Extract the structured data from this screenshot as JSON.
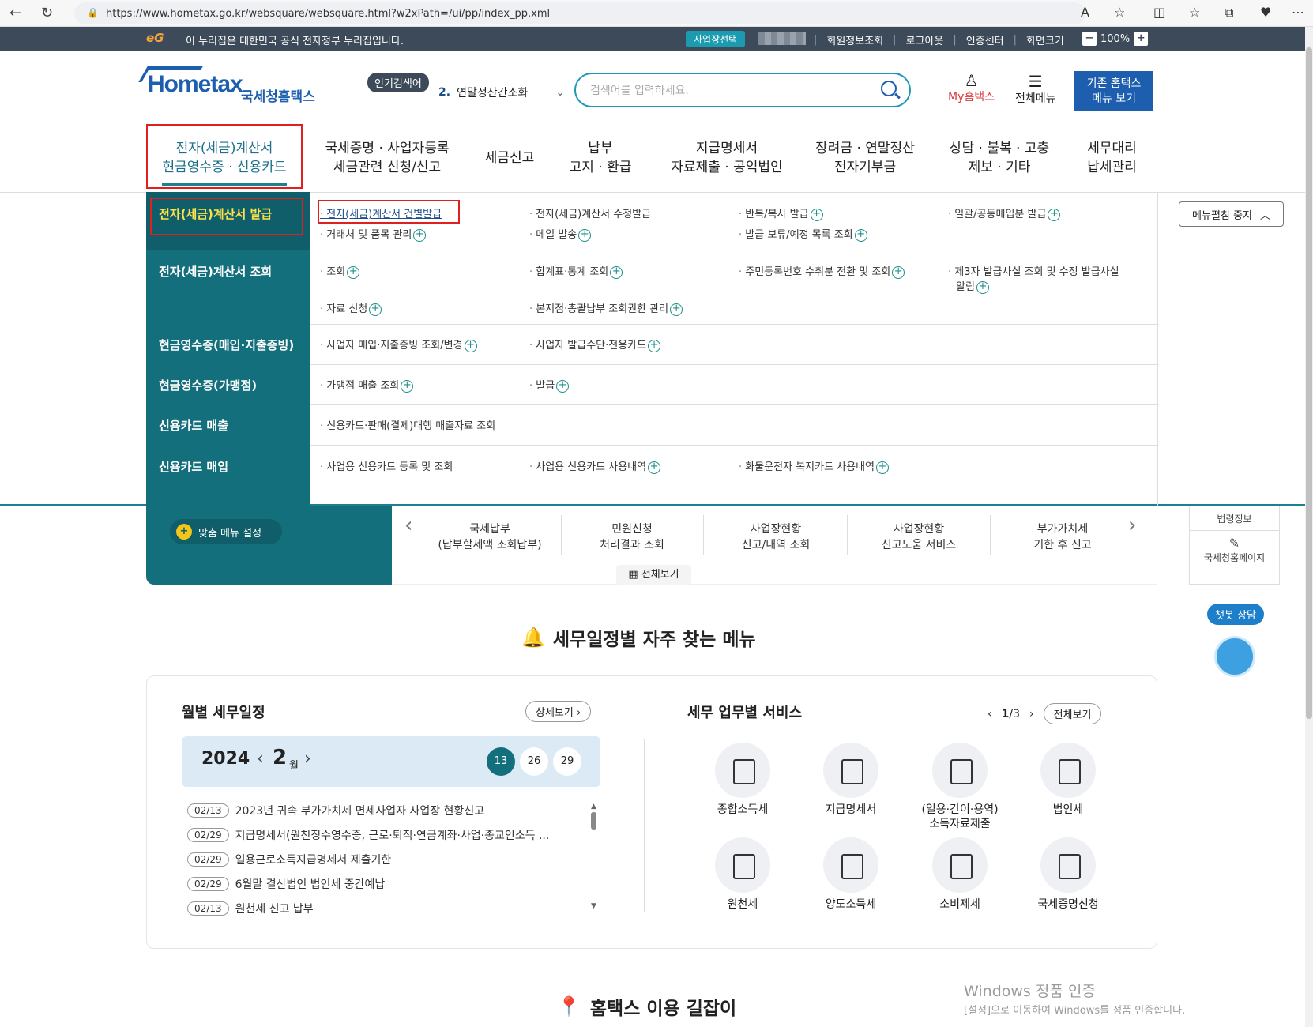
{
  "browser": {
    "url": "https://www.hometax.go.kr/websquare/websquare.html?w2xPath=/ui/pp/index_pp.xml"
  },
  "gov_banner": {
    "text": "이 누리집은 대한민국 공식 전자정부 누리집입니다.",
    "biz_select": "사업장선택",
    "links": [
      "회원정보조회",
      "로그아웃",
      "인증센터",
      "화면크기"
    ],
    "zoom": "100%"
  },
  "header": {
    "logo_en": "Hometax",
    "logo_kr": "국세청홈택스",
    "popular_label": "인기검색어",
    "popular_rank": "2.",
    "popular_keyword": "연말정산간소화",
    "search_placeholder": "검색어를 입력하세요.",
    "my_label": "My홈택스",
    "all_menu_label": "전체메뉴",
    "old_menu_line1": "기존 홈택스",
    "old_menu_line2": "메뉴 보기"
  },
  "tabs": [
    {
      "l1": "전자(세금)계산서",
      "l2": "현금영수증 · 신용카드"
    },
    {
      "l1": "국세증명 · 사업자등록",
      "l2": "세금관련 신청/신고"
    },
    {
      "l1": "세금신고",
      "l2": ""
    },
    {
      "l1": "납부",
      "l2": "고지 · 환급"
    },
    {
      "l1": "지급명세서",
      "l2": "자료제출 · 공익법인"
    },
    {
      "l1": "장려금 · 연말정산",
      "l2": "전자기부금"
    },
    {
      "l1": "상담 · 불복 · 고충",
      "l2": "제보 · 기타"
    },
    {
      "l1": "세무대리",
      "l2": "납세관리"
    }
  ],
  "mega_menu": {
    "categories": [
      "전자(세금)계산서 발급",
      "전자(세금)계산서 조회",
      "현금영수증(매입·지출증빙)",
      "현금영수증(가맹점)",
      "신용카드 매출",
      "신용카드 매입"
    ],
    "items": {
      "c0": [
        "전자(세금)계산서 건별발급",
        "전자(세금)계산서 수정발급",
        "반복/복사 발급",
        "일괄/공동매입분 발급",
        "거래처 및 품목 관리",
        "메일 발송",
        "발급 보류/예정 목록 조회"
      ],
      "c1": [
        "조회",
        "합계표·통계 조회",
        "주민등록번호 수취분 전환 및 조회",
        "제3자 발급사실 조회 및 수정 발급사실",
        "알림",
        "자료 신청",
        "본지점·총괄납부 조회권한 관리"
      ],
      "c2": [
        "사업자 매입·지출증빙 조회/변경",
        "사업자 발급수단·전용카드"
      ],
      "c3": [
        "가맹점 매출 조회",
        "발급"
      ],
      "c4": [
        "신용카드·판매(결제)대행 매출자료 조회"
      ],
      "c5": [
        "사업용 신용카드 등록 및 조회",
        "사업용 신용카드 사용내역",
        "화물운전자 복지카드 사용내역"
      ]
    },
    "collapse_label": "메뉴펼침 중지"
  },
  "quick": {
    "custom_label": "맞춤 메뉴 설정",
    "items": [
      {
        "l1": "국세납부",
        "l2": "(납부할세액 조회납부)"
      },
      {
        "l1": "민원신청",
        "l2": "처리결과 조회"
      },
      {
        "l1": "사업장현황",
        "l2": "신고/내역 조회"
      },
      {
        "l1": "사업장현황",
        "l2": "신고도움 서비스"
      },
      {
        "l1": "부가가치세",
        "l2": "기한 후 신고"
      }
    ],
    "all_view": "전체보기",
    "side": [
      "법령정보",
      "국세청홈페이지"
    ],
    "chatbot": "챗봇 상담"
  },
  "schedule_section": {
    "title": "세무일정별 자주 찾는 메뉴",
    "monthly_title": "월별 세무일정",
    "detail_btn": "상세보기",
    "year": "2024",
    "month": "2",
    "month_unit": "월",
    "days": [
      "13",
      "26",
      "29"
    ],
    "events": [
      {
        "date": "02/13",
        "text": "2023년 귀속 부가가치세 면세사업자 사업장 현황신고"
      },
      {
        "date": "02/29",
        "text": "지급명세서(원천징수영수증, 근로·퇴직·연금계좌·사업·종교인소득 ..."
      },
      {
        "date": "02/29",
        "text": "일용근로소득지급명세서 제출기한"
      },
      {
        "date": "02/29",
        "text": "6월말 결산법인 법인세 중간예납"
      },
      {
        "date": "02/13",
        "text": "원천세 신고 납부"
      }
    ],
    "service_title": "세무 업무별 서비스",
    "page": "1",
    "pages": "/3",
    "all_btn": "전체보기",
    "services": [
      "종합소득세",
      "지급명세서",
      "(일용·간이·용역)",
      "소득자료제출",
      "법인세",
      "원천세",
      "양도소득세",
      "소비제세",
      "국세증명신청"
    ]
  },
  "guide_title": "홈택스 이용 길잡이",
  "windows_notice": {
    "l1": "Windows 정품 인증",
    "l2": "[설정]으로 이동하여 Windows를 정품 인증합니다."
  }
}
